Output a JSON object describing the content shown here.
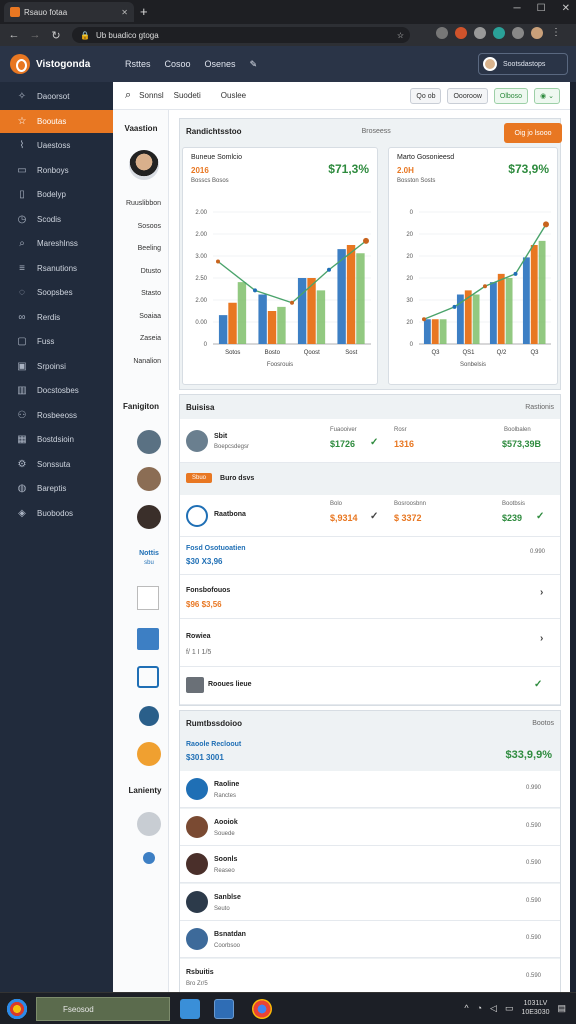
{
  "browser": {
    "tab_title": "Rsauo fotaa",
    "url": "Ub buadico gtoga"
  },
  "app": {
    "brand": "Vistogonda",
    "nav": [
      "Rsttes",
      "Cosoo",
      "Osenes"
    ],
    "user": "Sootsdastops"
  },
  "sidebar": {
    "items": [
      {
        "label": "Daoorsot",
        "icon": "compass-icon"
      },
      {
        "label": "Booutas",
        "icon": "star-icon",
        "active": true
      },
      {
        "label": "Uaestoss",
        "icon": "chart-icon"
      },
      {
        "label": "Ronboys",
        "icon": "folder-icon"
      },
      {
        "label": "Bodelyp",
        "icon": "document-icon"
      },
      {
        "label": "Scodis",
        "icon": "clock-icon"
      },
      {
        "label": "Mareshlnss",
        "icon": "search-icon"
      },
      {
        "label": "Rsanutions",
        "icon": "list-icon"
      },
      {
        "label": "Soopsbes",
        "icon": "chat-icon"
      },
      {
        "label": "Rerdis",
        "icon": "link-icon"
      },
      {
        "label": "Fuss",
        "icon": "file-icon"
      },
      {
        "label": "Srpoinsi",
        "icon": "box-icon"
      },
      {
        "label": "Docstosbes",
        "icon": "book-icon"
      },
      {
        "label": "Rosbeeoss",
        "icon": "users-icon"
      },
      {
        "label": "Bostdsioin",
        "icon": "grid-icon"
      },
      {
        "label": "Sonssuta",
        "icon": "gear-icon"
      },
      {
        "label": "Bareptis",
        "icon": "globe-icon"
      },
      {
        "label": "Buobodos",
        "icon": "layers-icon"
      }
    ]
  },
  "topbar": {
    "links": [
      "Sonnsl",
      "Suodeti",
      "Ouslee"
    ],
    "buttons": [
      "Qo ob",
      "Oooroow",
      "Olboso"
    ]
  },
  "leftcol": {
    "head1": "Vaastion",
    "items1": [
      "Ruuslibbon",
      "Sosoos",
      "Beeling",
      "Dtusto",
      "Stasto",
      "Soaiaa",
      "Zaseia",
      "Nanalion"
    ],
    "head2": "Fanigiton",
    "badge": "Nottis",
    "badge_sub": "sbu",
    "head3": "Lanienty"
  },
  "overview": {
    "title": "Randichtsstoo",
    "meta": "Broseess",
    "button": "Oig jo lsooo"
  },
  "charts": [
    {
      "title": "Buneue Somlcio",
      "sub": "2016",
      "sub2": "Bosscs Bosos",
      "big": "$71,3%",
      "xlabel": "Foosrouis",
      "yticks": [
        "2.00",
        "2.00",
        "3.00",
        "2.50",
        "2.00",
        "0.00",
        "0"
      ],
      "chart_data": {
        "type": "bar",
        "categories": [
          "Sotos",
          "Bosto",
          "Qoost",
          "Sost"
        ],
        "series": [
          {
            "values": [
              0.7,
              1.2,
              1.6,
              2.3
            ]
          },
          {
            "values": [
              1.0,
              0.8,
              1.6,
              2.4
            ]
          },
          {
            "values": [
              1.5,
              0.9,
              1.3,
              2.2
            ]
          }
        ],
        "line": [
          2.0,
          1.3,
          1.0,
          1.8,
          2.5
        ],
        "ylim": [
          0,
          3.2
        ]
      }
    },
    {
      "title": "Marto Gosonieesd",
      "sub": "2.0H",
      "sub2": "Bosston Sosts",
      "big": "$73,9%",
      "xlabel": "Sonbelsis",
      "yticks": [
        "0",
        "20",
        "20",
        "20",
        "30",
        "20",
        "0"
      ],
      "chart_data": {
        "type": "bar",
        "categories": [
          "Q3",
          "QS1",
          "Q/2",
          "Q3"
        ],
        "series": [
          {
            "values": [
              0.6,
              1.2,
              1.5,
              2.1
            ]
          },
          {
            "values": [
              0.6,
              1.3,
              1.7,
              2.4
            ]
          },
          {
            "values": [
              0.6,
              1.2,
              1.6,
              2.5
            ]
          }
        ],
        "line": [
          0.6,
          0.9,
          1.4,
          1.7,
          2.9
        ],
        "ylim": [
          0,
          3.2
        ]
      }
    }
  ],
  "details": {
    "title": "Buisisa",
    "meta": "Rastionis",
    "row1": {
      "name": "Sbit",
      "sub": "Boepcsdegsr",
      "col1": "Fuaooiver",
      "amt1": "$1726",
      "col2": "Rosr",
      "amt2": "1316",
      "col3": "Boolbalen",
      "amt3": "$573,39B"
    },
    "tag": "Sbuo",
    "tag_title": "Buro dsvs",
    "row2": {
      "name": "Raatbona",
      "col1": "Bolo",
      "amt1": "$,9314",
      "col2": "Bosroosbnn",
      "amt2": "$ 3372",
      "col3": "Bootbsis",
      "amt3": "$239"
    },
    "row3": {
      "name": "Fosd Osotuoatien",
      "amt": "$30 X3,96",
      "right": "0.990"
    },
    "row4": {
      "name": "Fonsbofouos",
      "amt": "$96 $3,56"
    },
    "row5": {
      "name": "Rowiea",
      "amt": "f/ 1 I 1/5"
    },
    "row6": {
      "name": "Rooues lieue"
    }
  },
  "summary": {
    "title": "Rumtbssdoioo",
    "meta": "Bootos",
    "head": {
      "name": "Raoole Recloout",
      "amt": "$301 3001",
      "big": "$33,9,9%"
    },
    "rows": [
      {
        "name": "Raoline",
        "sub": "Ranctes",
        "value": "0.990"
      },
      {
        "name": "Aooiok",
        "sub": "Souede",
        "value": "0.590"
      },
      {
        "name": "Soonls",
        "sub": "Reaseo",
        "value": "0.590"
      },
      {
        "name": "Sanblse",
        "sub": "Seuto",
        "value": "0.590"
      },
      {
        "name": "Bsnatdan",
        "sub": "Coorbsoo",
        "value": "0.590"
      },
      {
        "name": "Rsbuitis",
        "sub": "Bro Zr/5",
        "value": "0.590"
      }
    ]
  },
  "taskbar": {
    "search": "Fseosod",
    "time": "1031LV",
    "date": "10E3030"
  },
  "colors": {
    "accent": "#e87722",
    "blue": "#3d7fc4",
    "green": "#2e8b3e",
    "sidebar": "#212b3c"
  }
}
